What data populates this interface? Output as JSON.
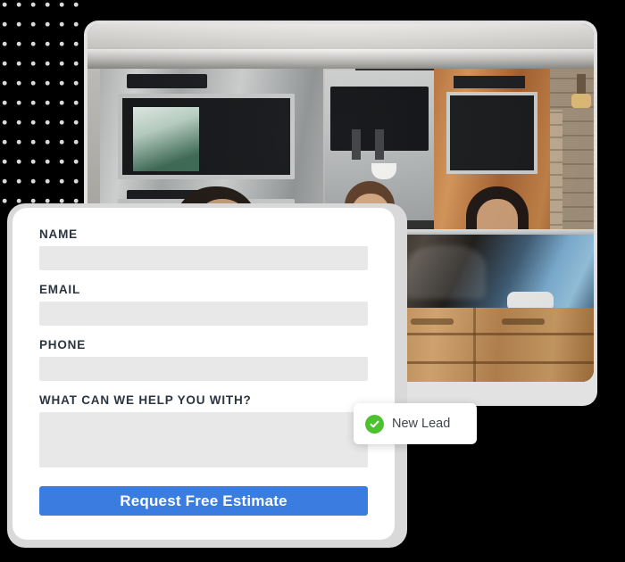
{
  "background": {
    "color": "#000000",
    "dot_pattern": {
      "name": "dot-grid-decoration",
      "dot_color": "#d9d9d9"
    }
  },
  "photo_card": {
    "name": "kitchen-photo-card",
    "alt": "Three women in white shirts cleaning a modern kitchen with stainless steel appliances, stone wall and wood cabinets",
    "frame_color": "#e2e2e2"
  },
  "form": {
    "card_background": "#ffffff",
    "shadow_color": "#d9d9d9",
    "fields": [
      {
        "label": "NAME",
        "value": "",
        "placeholder": ""
      },
      {
        "label": "EMAIL",
        "value": "",
        "placeholder": ""
      },
      {
        "label": "PHONE",
        "value": "",
        "placeholder": ""
      }
    ],
    "message_field": {
      "label": "WHAT CAN WE HELP YOU WITH?",
      "value": "",
      "placeholder": ""
    },
    "submit": {
      "label": "Request Free Estimate",
      "background": "#3b7ce0",
      "text_color": "#ffffff"
    },
    "label_color": "#2b3440",
    "input_background": "#e8e8e8"
  },
  "toast": {
    "name": "new-lead-toast",
    "label": "New Lead",
    "icon": "check-circle-icon",
    "icon_color": "#4cc22e",
    "background": "#ffffff",
    "text_color": "#40464d"
  }
}
